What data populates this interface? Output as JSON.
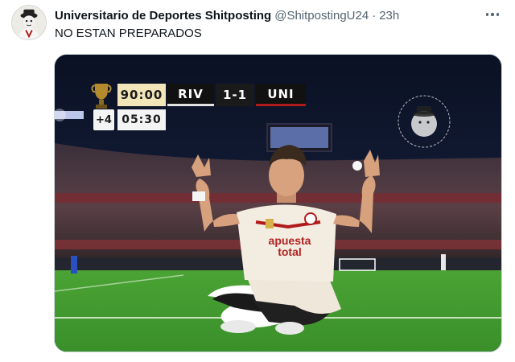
{
  "author": {
    "display_name": "Universitario de Deportes Shitposting",
    "handle": "@ShitpostingU24",
    "separator": "·",
    "time": "23h"
  },
  "tweet": {
    "text": "NO ESTAN PREPARADOS"
  },
  "icons": {
    "more": "more-horizontal-icon",
    "trophy": "trophy-icon"
  },
  "scoreboard": {
    "clock": "90:00",
    "home": "RIV",
    "score": "1-1",
    "away": "UNI",
    "added_time": "+4",
    "extra_clock": "05:30"
  },
  "jersey": {
    "line1": "apuesta",
    "line2": "total"
  },
  "colors": {
    "text_primary": "#0f1419",
    "text_secondary": "#536471",
    "pitch": "#3f9a2e",
    "jersey": "#f3ece1",
    "sponsor": "#b22222"
  }
}
